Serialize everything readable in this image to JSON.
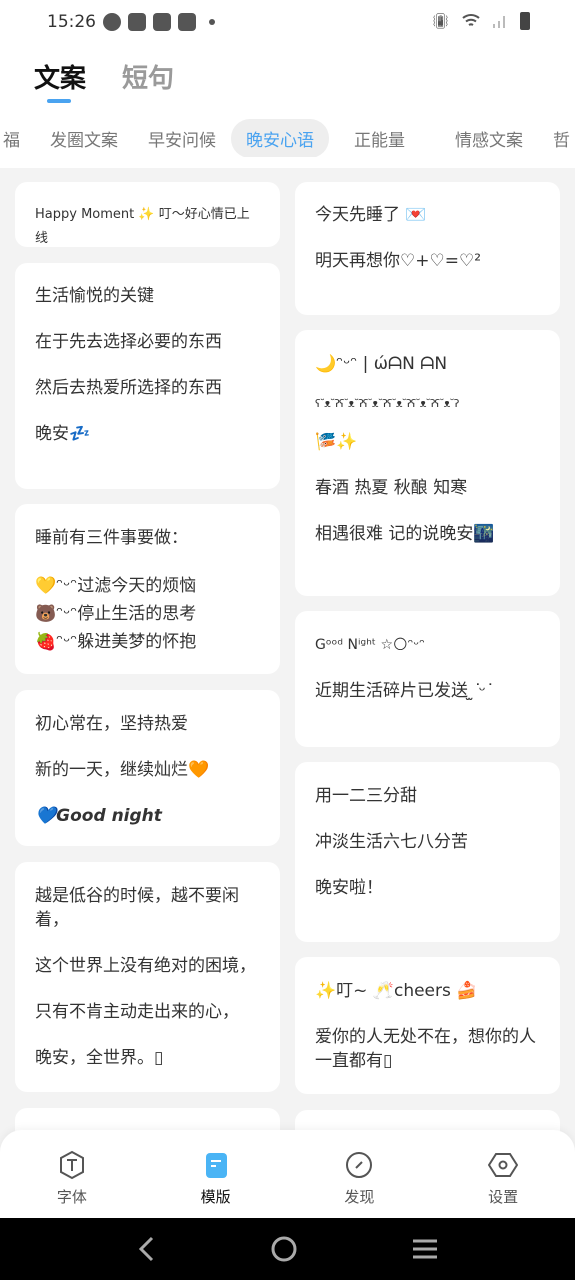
{
  "status_bar": {
    "time": "15:26",
    "icons": [
      "speedometer-icon",
      "bag-icon",
      "bag-icon",
      "bag-icon",
      "dot-icon"
    ],
    "right_icons": [
      "vibrate-icon",
      "wifi-icon",
      "signal-icon",
      "battery-icon"
    ]
  },
  "main_tabs": [
    {
      "label": "文案",
      "active": true
    },
    {
      "label": "短句",
      "active": false
    }
  ],
  "categories": [
    {
      "label": "福"
    },
    {
      "label": "发圈文案"
    },
    {
      "label": "早安问候"
    },
    {
      "label": "晚安心语",
      "active": true
    },
    {
      "label": "正能量"
    },
    {
      "label": "情感文案"
    },
    {
      "label": "哲"
    }
  ],
  "accent": "#4aa3f0",
  "cards_left": [
    {
      "lines": [
        "Happy Moment ✨ 叮～好心情已上线"
      ]
    },
    {
      "lines": [
        "生活愉悦的关键",
        "在于先去选择必要的东西",
        "然后去热爱所选择的东西",
        "晚安💤"
      ]
    },
    {
      "lines": [
        "睡前有三件事要做：",
        "💛ᵔᵕᵔ过滤今天的烦恼",
        "🐻ᵔᵕᵔ停止生活的思考",
        "🍓ᵔᵕᵔ躲进美梦的怀抱"
      ]
    },
    {
      "lines": [
        "初心常在，坚持热爱",
        "新的一天，继续灿烂🧡",
        "💙Good night"
      ]
    },
    {
      "lines": [
        "越是低谷的时候，越不要闲着，",
        "这个世界上没有绝对的困境，",
        "只有不肯主动走出来的心，",
        "晚安，全世界。▯"
      ]
    }
  ],
  "cards_right": [
    {
      "lines": [
        "今天先睡了 💌",
        "明天再想你♡+♡=♡²"
      ]
    },
    {
      "lines": [
        "🌙ᵔᵕᵔ |  ώᗩN ᗩN",
        "ʕ˘ᴥ˘ʔʕ˘ᴥ˘ʔʕ˘ᴥ˘ʔʕ˘ᴥ˘ʔʕ˘ᴥ˘ʔʕ˘ᴥ˘ʔ",
        "🎏✨",
        "春酒 热夏 秋酿 知寒",
        "相遇很难 记的说晚安🌃"
      ]
    },
    {
      "lines": [
        "Gᵒᵒᵈ Nⁱᵍʰᵗ ☆🌕ᵔᵕᵔ",
        "近期生活碎片已发送 ̫ ͘ᵕ ͘"
      ]
    },
    {
      "lines": [
        "用一二三分甜",
        "冲淡生活六七八分苦",
        "晚安啦！"
      ]
    },
    {
      "lines": [
        "✨叮~ 🥂cheers 🍰",
        "爱你的人无处不在，想你的人一直都有▯"
      ]
    }
  ],
  "bottom_nav": [
    {
      "label": "字体",
      "icon": "font-icon"
    },
    {
      "label": "模版",
      "icon": "template-icon",
      "active": true
    },
    {
      "label": "发现",
      "icon": "compass-icon"
    },
    {
      "label": "设置",
      "icon": "settings-icon"
    }
  ],
  "system_nav": [
    "back-icon",
    "home-icon",
    "recents-icon"
  ]
}
